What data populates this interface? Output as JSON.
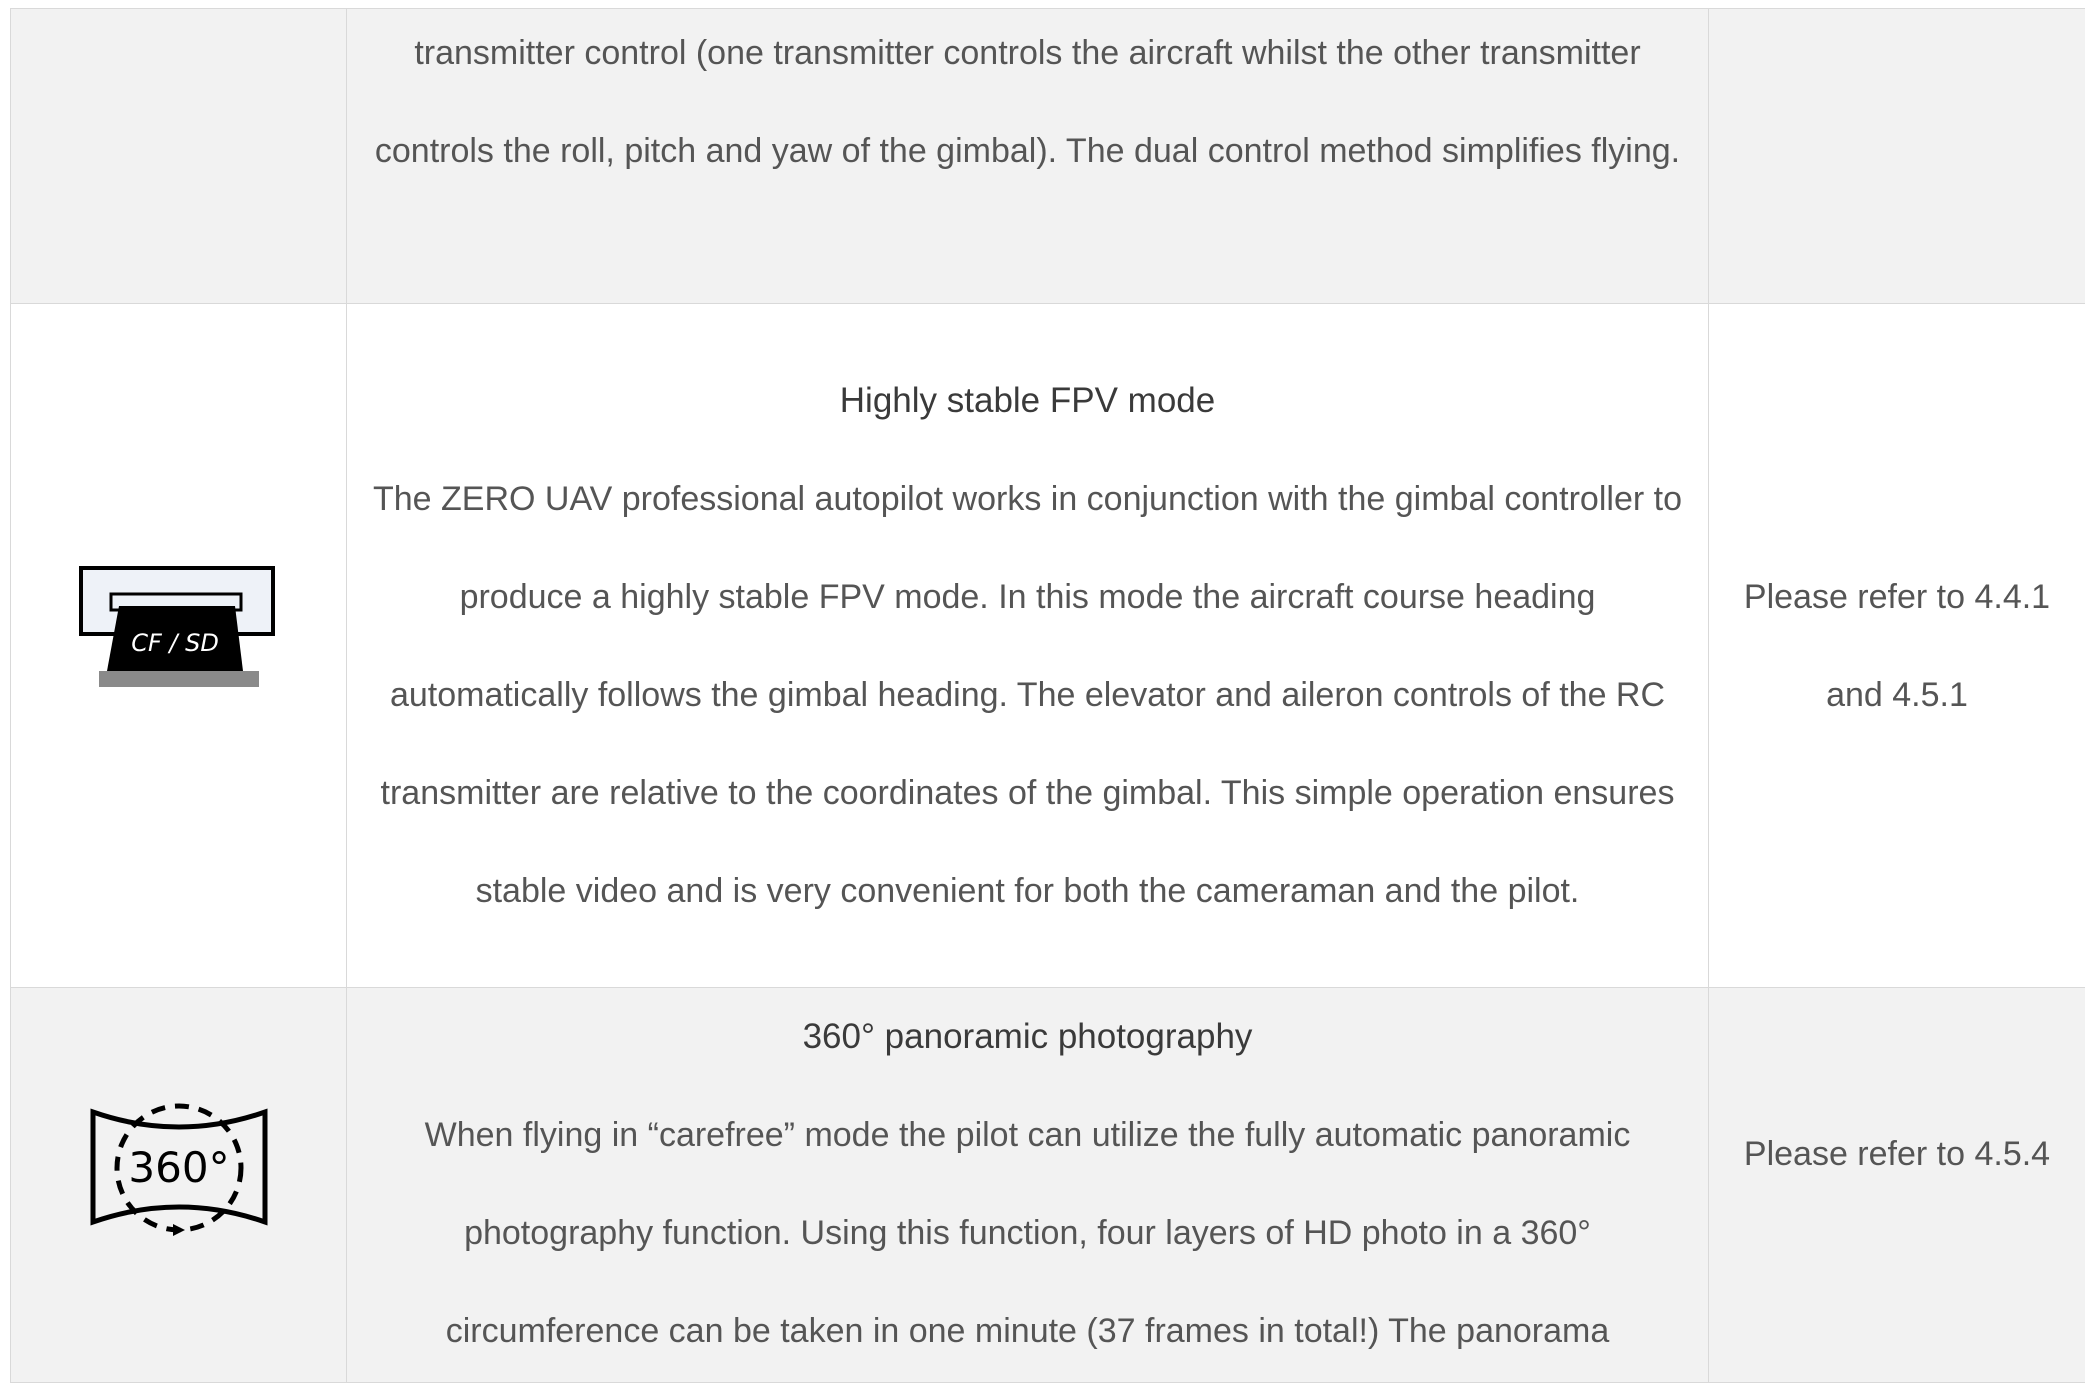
{
  "rows": [
    {
      "icon": "",
      "title": "",
      "description": "transmitter control (one transmitter controls the aircraft whilst the other transmitter controls the roll, pitch and yaw of the gimbal). The dual control method simplifies flying.",
      "reference": ""
    },
    {
      "icon": "cf-sd-card-icon",
      "icon_label": "CF / SD",
      "title": "Highly stable FPV mode",
      "description": "The ZERO UAV professional autopilot works in conjunction with the gimbal controller to produce a highly stable FPV mode. In this mode the aircraft course heading automatically follows the gimbal heading. The elevator and aileron controls of the RC transmitter are relative to the coordinates of the gimbal. This simple operation ensures stable video and is very convenient for both the cameraman and the pilot.",
      "reference": "Please refer to 4.4.1 and 4.5.1"
    },
    {
      "icon": "panorama-360-icon",
      "icon_label": "360°",
      "title": "360° panoramic photography",
      "description": "When flying in “carefree” mode the pilot can utilize the fully automatic panoramic photography function. Using this function, four layers of HD photo in a 360° circumference can be taken in one minute (37 frames in total!) The panorama",
      "reference": "Please refer to 4.5.4"
    }
  ],
  "colors": {
    "grey_row": "#f2f2f2",
    "white_row": "#ffffff",
    "border": "#d9d9d9",
    "text": "#555555"
  }
}
